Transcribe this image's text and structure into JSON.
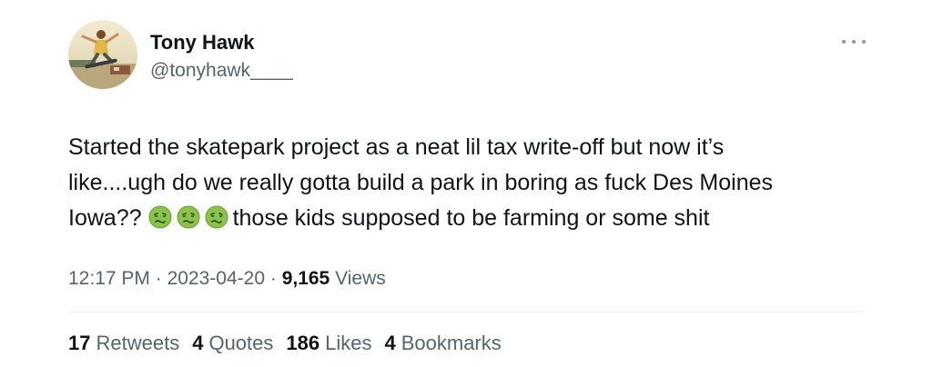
{
  "author": {
    "display_name": "Tony Hawk",
    "handle": "@tonyhawk____"
  },
  "tweet": {
    "line1": "Started the skatepark project as a neat lil tax write-off but now it’s",
    "line2": "like....ugh do we really gotta build a park in boring as fuck Des Moines",
    "line3_start": "Iowa?? ",
    "emojis": [
      "nauseated-face",
      "nauseated-face",
      "nauseated-face"
    ],
    "line3_end": "those  kids supposed to be farming or some  shit"
  },
  "meta": {
    "time": "12:17 PM",
    "separator": "·",
    "date": "2023-04-20",
    "views_count": "9,165",
    "views_label": "Views"
  },
  "stats": {
    "retweets_count": "17",
    "retweets_label": "Retweets",
    "quotes_count": "4",
    "quotes_label": "Quotes",
    "likes_count": "186",
    "likes_label": "Likes",
    "bookmarks_count": "4",
    "bookmarks_label": "Bookmarks"
  },
  "colors": {
    "text_primary": "#0f1419",
    "text_secondary": "#536471",
    "divider": "#eff3f4",
    "emoji_face": "#8bc34a"
  }
}
